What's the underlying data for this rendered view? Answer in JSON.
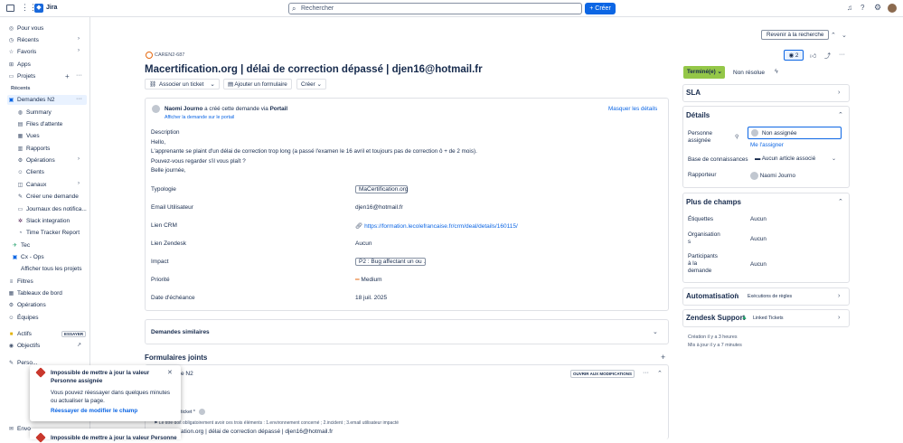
{
  "topbar": {
    "app_name": "Jira",
    "search_placeholder": "Rechercher",
    "create_label": "Créer"
  },
  "sidebar": {
    "for_you": "Pour vous",
    "recent": "Récents",
    "favorites": "Favoris",
    "apps": "Apps",
    "projects": "Projets",
    "recent_label": "Récents",
    "project_name": "Demandes N2",
    "items": [
      "Summary",
      "Files d'attente",
      "Vues",
      "Rapports",
      "Opérations",
      "Clients",
      "Canaux",
      "Créer une demande",
      "Journaux des notifica...",
      "Slack integration",
      "Time Tracker Report"
    ],
    "tec": "Tec",
    "cx_ops": "Cx - Ops",
    "all_projects": "Afficher tous les projets",
    "filters": "Filtres",
    "dashboards": "Tableaux de bord",
    "operations": "Opérations",
    "teams": "Équipes",
    "assets": "Actifs",
    "try_badge": "ESSAYER",
    "goals": "Objectifs",
    "personalize": "Perso...",
    "feedback": "Envo..."
  },
  "issue": {
    "key": "CAREN2-687",
    "title": "Macertification.org | délai de correction dépassé | djen16@hotmail.fr",
    "link_ticket": "Associer un ticket",
    "add_form": "Ajouter un formulaire",
    "create": "Créer",
    "back_to_search": "Revenir à la recherche",
    "watchers": "2",
    "reporter_name": "Naomi Journo",
    "created_text": "a créé cette demande via",
    "portal": "Portail",
    "view_portal": "Afficher la demande sur le portail",
    "hide_details": "Masquer les détails",
    "description_label": "Description",
    "description_lines": [
      "Hello,",
      "L'apprenante se plaint d'un délai de correction trop long (a passé l'examen le 16 avril et toujours pas de correction ô + de 2 mois).",
      "Pouvez-vous regarder s'il vous plaît ?",
      "Belle journée,"
    ],
    "fields": [
      {
        "label": "Typologie",
        "value": "MaCertification.org"
      },
      {
        "label": "Email Utilisateur",
        "value": "djen16@hotmail.fr"
      },
      {
        "label": "Lien CRM",
        "value": "https://formation.lecolefrancaise.fr/crm/deal/details/160115/"
      },
      {
        "label": "Lien Zendesk",
        "value": "Aucun"
      },
      {
        "label": "Impact",
        "value": "P2 : Bug affectant un ou ..."
      },
      {
        "label": "Priorité",
        "value": "Medium"
      },
      {
        "label": "Date d'échéance",
        "value": "18 juil. 2025"
      }
    ],
    "similar": "Demandes similaires",
    "forms_joined": "Formulaires joints",
    "form_name": "e N2",
    "open_mods": "OUVRIR AUX MODIFICATIONS",
    "ticket_label": "ticket *",
    "hint": "Le titre doit obligatoirement avoir ces trois éléments : 1.environnement concerné ; 2.incident ; 3.email utilisateur impacté",
    "bottom_title": "ation.org | délai de correction dépassé | djen16@hotmail.fr"
  },
  "right": {
    "status": "Terminé(e)",
    "resolution": "Non résolue",
    "sla": "SLA",
    "details": "Détails",
    "assignee_label": "Personne assignée",
    "assignee_value": "Non assignée",
    "assign_me": "Me l'assigner",
    "kb_label": "Base de connaissances",
    "kb_value": "Aucun article associé",
    "reporter_label": "Rapporteur",
    "reporter_value": "Naomi Journo",
    "more_fields": "Plus de champs",
    "labels_label": "Étiquettes",
    "labels_value": "Aucun",
    "org_label": "Organisations",
    "org_value": "Aucun",
    "participants_label": "Participants à la demande",
    "participants_value": "Aucun",
    "automation": "Automatisation",
    "rules": "Exécutions de règles",
    "zendesk": "Zendesk Support",
    "linked": "Linked Tickets",
    "created": "Création il y a 3 heures",
    "updated": "Mis à jour il y a 7 minutes"
  },
  "toast": {
    "title": "Impossible de mettre à jour la valeur Personne assignée",
    "body": "Vous pouvez réessayer dans quelques minutes ou actualiser la page.",
    "retry": "Réessayer de modifier le champ",
    "title2": "Impossible de mettre à jour la valeur Personne"
  },
  "colors": {
    "accent": "#0c66e4",
    "status": "#94c748",
    "error": "#c9372c"
  }
}
